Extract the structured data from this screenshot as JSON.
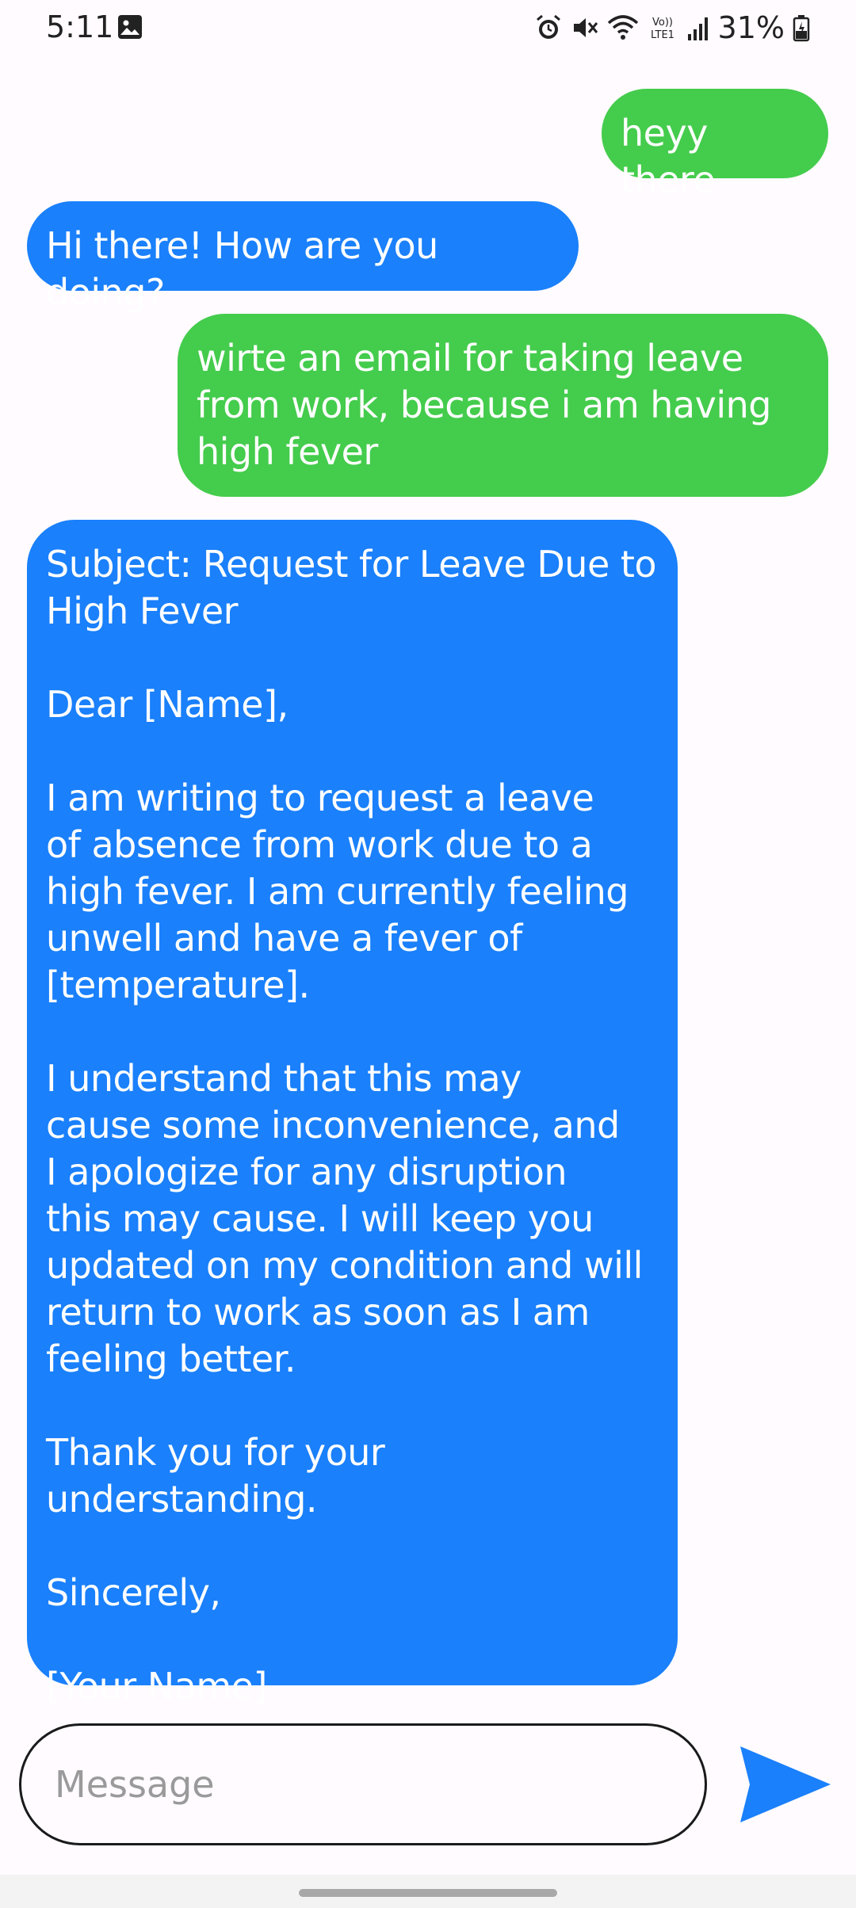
{
  "status_bar": {
    "time": "5:11",
    "battery": "31%",
    "icons": [
      "image-icon",
      "alarm-icon",
      "mute-icon",
      "wifi-icon",
      "volte-icon",
      "signal-icon",
      "battery-icon"
    ],
    "volte_label": "Vo)) LTE1"
  },
  "chat": {
    "messages": [
      {
        "role": "user",
        "text": "heyy there"
      },
      {
        "role": "assistant",
        "text": "Hi there! How are you doing?"
      },
      {
        "role": "user",
        "text": "wirte an email for taking leave\nfrom work, because i am having\nhigh fever"
      },
      {
        "role": "assistant",
        "text": "Subject: Request for Leave Due to\nHigh Fever\n\nDear [Name],\n\nI am writing to request a leave\nof absence from work due to a\nhigh fever. I am currently feeling\nunwell and have a fever of\n[temperature].\n\nI understand that this may\ncause some inconvenience, and\nI apologize for any disruption\nthis may cause. I will keep you\nupdated on my condition and will\nreturn to work as soon as I am\nfeeling better.\n\nThank you for your understanding.\n\nSincerely,\n\n[Your Name]"
      }
    ]
  },
  "composer": {
    "placeholder": "Message",
    "value": "",
    "send_icon": "send-icon"
  },
  "colors": {
    "user_bubble": "#44cc4c",
    "assistant_bubble": "#1a80fb",
    "send_accent": "#1a80fb",
    "background": "#fffbfe"
  }
}
